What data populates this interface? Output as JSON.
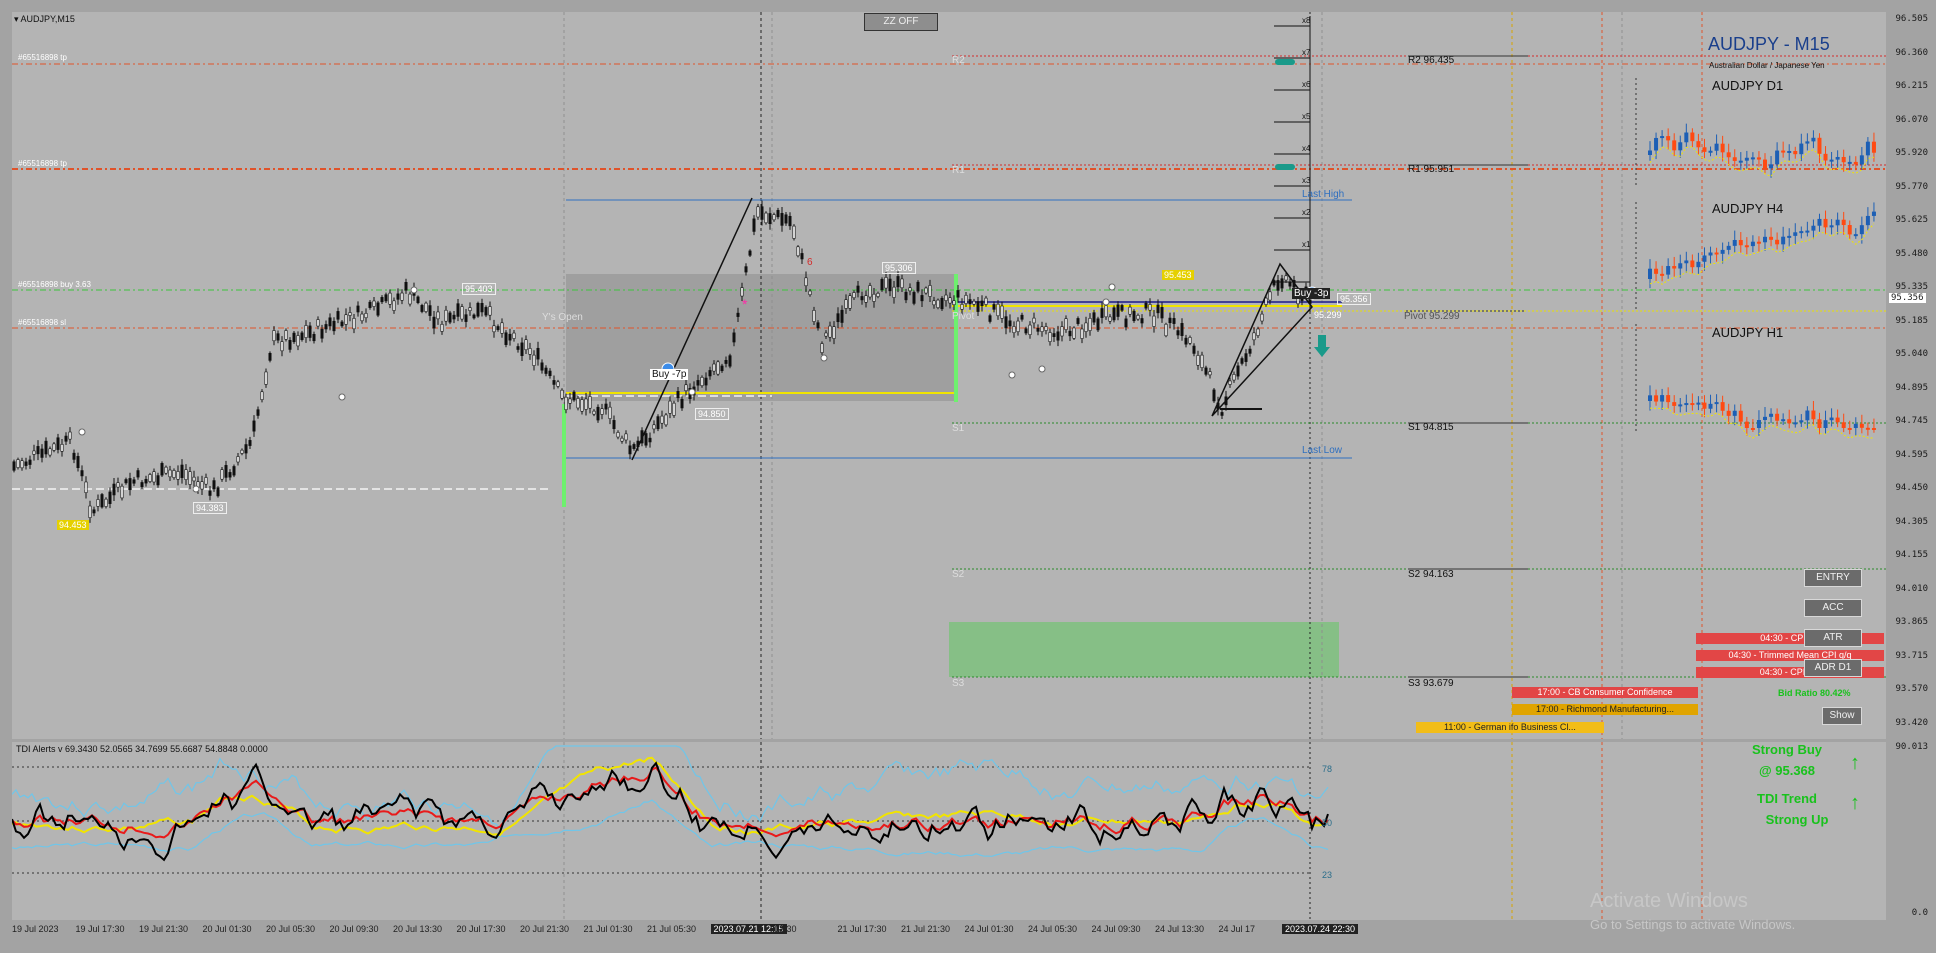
{
  "window": {
    "symbol_label": "AUDJPY,M15",
    "zz_button": "ZZ OFF"
  },
  "trade_lines": {
    "tp_label_1": "#65516898 tp",
    "tp_label_2": "#65516898 tp",
    "buy_label": "#65516898 buy 3.63",
    "sl_label": "#65516898 sl"
  },
  "chart_title": {
    "pair": "AUDJPY - M15",
    "description": "Australian Dollar / Japanese Yen"
  },
  "pivots": {
    "r2": "R2 96.435",
    "r1": "R1 95.951",
    "pivot": "Pivot 95.299",
    "s1": "S1 94.815",
    "s2": "S2 94.163",
    "s3": "S3 93.679",
    "r2_short": "R2",
    "r1_short": "R1",
    "s1_short": "S1",
    "s2_short": "S2",
    "s3_short": "S3",
    "pivot_short": "Pivot"
  },
  "annotations": {
    "y_open": "Y's Open",
    "last_high": "Last High",
    "last_low": "Last Low",
    "buy_tag_1": "Buy -7p",
    "buy_tag_2": "Buy -3p",
    "level_95403": "95.403",
    "level_95453": "95.453",
    "level_94850": "94.850",
    "level_95356": "95.356",
    "level_95299": "95.299",
    "level_95306": "95.306",
    "level_left_1": "94.453",
    "level_left_2": "94.383",
    "fib_labels": [
      "x8",
      "x7",
      "x6",
      "x5",
      "x4",
      "x3",
      "x2",
      "x1"
    ]
  },
  "mini_charts": {
    "d1": "AUDJPY D1",
    "h4": "AUDJPY H4",
    "h1": "AUDJPY H1"
  },
  "side_buttons": [
    "ENTRY",
    "ACC",
    "ATR",
    "ADR D1"
  ],
  "show_button": "Show",
  "news_items": [
    {
      "text": "04:30 - CPI y/y",
      "color": "red"
    },
    {
      "text": "04:30 - Trimmed Mean CPI q/q",
      "color": "red"
    },
    {
      "text": "04:30 - CPI q/q",
      "color": "red"
    },
    {
      "text": "17:00 - CB Consumer Confidence",
      "color": "red"
    },
    {
      "text": "17:00 - Richmond Manufacturing...",
      "color": "orange"
    },
    {
      "text": "11:00 - German ifo Business Cl...",
      "color": "yellow"
    }
  ],
  "bid_ratio": "Bid Ratio 80.42%",
  "signals": {
    "strong_buy": "Strong Buy",
    "strong_buy_price": "@ 95.368",
    "tdi_trend": "TDI Trend",
    "strong_up": "Strong Up"
  },
  "price_axis": [
    "96.505",
    "96.360",
    "96.215",
    "96.070",
    "95.920",
    "95.770",
    "95.625",
    "95.480",
    "95.335",
    "95.185",
    "95.040",
    "94.895",
    "94.745",
    "94.595",
    "94.450",
    "94.305",
    "94.155",
    "94.010",
    "93.865",
    "93.715",
    "93.570",
    "93.420"
  ],
  "current_price": "95.356",
  "indicator": {
    "title": "TDI Alerts v 69.3430 52.0565 34.7699 55.6687 54.8848 0.0000",
    "levels": [
      "78",
      "50",
      "23"
    ],
    "scale_top": "90.013",
    "scale_bottom": "0.0"
  },
  "time_axis": [
    "19 Jul 2023",
    "19 Jul 17:30",
    "19 Jul 21:30",
    "20 Jul 01:30",
    "20 Jul 05:30",
    "20 Jul 09:30",
    "20 Jul 13:30",
    "20 Jul 17:30",
    "20 Jul 21:30",
    "21 Jul 01:30",
    "21 Jul 05:30",
    "2023.07.21 12:15",
    "13:30",
    "21 Jul 17:30",
    "21 Jul 21:30",
    "24 Jul 01:30",
    "24 Jul 05:30",
    "24 Jul 09:30",
    "24 Jul 13:30",
    "24 Jul 17",
    "2023.07.24 22:30"
  ],
  "watermark": {
    "line1": "Activate Windows",
    "line2": "Go to Settings to activate Windows."
  },
  "colors": {
    "background": "#b4b4b4",
    "tp_line": "#e0532a",
    "buy_line": "#3cc43c",
    "sl_line": "#e0532a",
    "pivot_green": "#2a8a2a",
    "pivot_red": "#d42b2b",
    "last_high_low": "#2f6fbf",
    "bull_candle": "#1d5fb5",
    "bear_candle": "#ff4a12",
    "tdi_price": "#000000",
    "tdi_signal": "#e81a1a",
    "tdi_base": "#f1e400",
    "tdi_band": "#6fc6ea"
  }
}
